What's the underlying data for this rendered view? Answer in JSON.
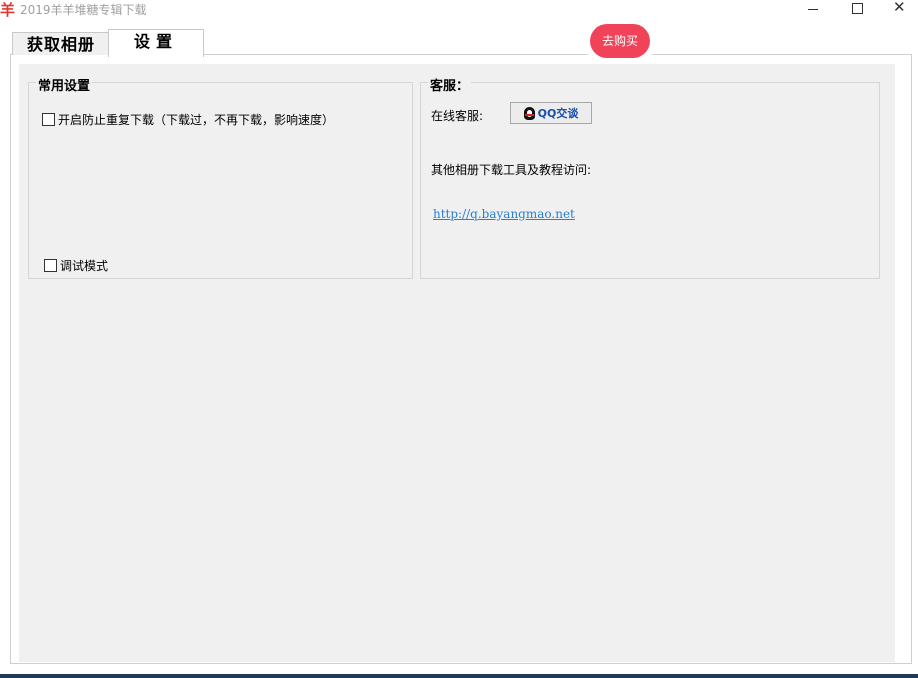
{
  "window": {
    "icon_glyph": "羊",
    "title": "2019羊羊堆糖专辑下载",
    "controls": {
      "minimize": "minimize-icon",
      "maximize": "maximize-icon",
      "close": "✕"
    }
  },
  "tabs": [
    {
      "label": "获取相册",
      "active": false
    },
    {
      "label": "设置",
      "active": true
    }
  ],
  "buy_button": {
    "label": "去购买",
    "color": "#f0435a"
  },
  "common_settings": {
    "title": "常用设置",
    "options": [
      {
        "label": "开启防止重复下载（下载过，不再下载，影响速度）",
        "checked": false
      },
      {
        "label": "调试模式",
        "checked": false
      }
    ]
  },
  "customer_service": {
    "title": "客服：",
    "online_label": "在线客服:",
    "qq_button_label": "QQ交谈",
    "other_tools_label": "其他相册下载工具及教程访问:",
    "link_text": "http://q.bayangmao.net",
    "link_color": "#2a7fd4"
  }
}
